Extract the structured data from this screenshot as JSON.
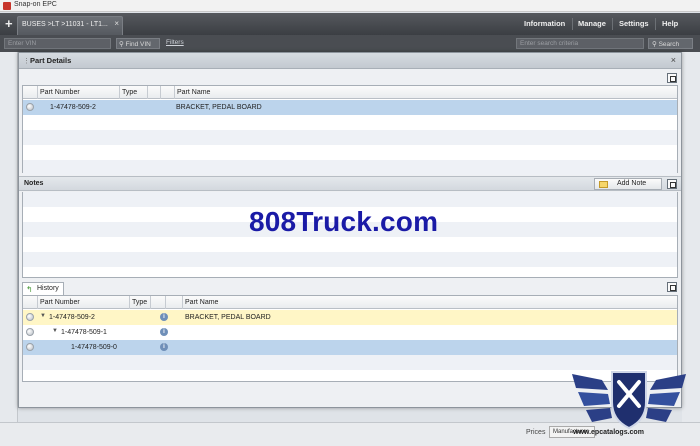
{
  "os": {
    "title": "Snap-on EPC"
  },
  "appbar": {
    "tab_label": "BUSES >LT >11031 - LT1...",
    "tab_close": "×",
    "menu": [
      "Information",
      "Manage",
      "Settings",
      "Help"
    ]
  },
  "searchbar": {
    "vin_placeholder": "Enter VIN",
    "find_vin": "Find VIN",
    "filters": "Filters",
    "criteria_placeholder": "Enter search criteria",
    "search": "Search"
  },
  "dialog": {
    "title": "Part Details",
    "close": "×",
    "parts_grid": {
      "columns": [
        "Part Number",
        "Type",
        "Part Name"
      ],
      "rows": [
        {
          "part_number": "1-47478-509-2",
          "type": "",
          "part_name": "BRACKET, PEDAL BOARD",
          "selected": true
        }
      ]
    },
    "notes": {
      "label": "Notes",
      "add_note": "Add Note"
    },
    "history": {
      "tab": "History",
      "columns": [
        "Part Number",
        "Type",
        "Part Name"
      ],
      "rows": [
        {
          "part_number": "1-47478-509-2",
          "part_name": "BRACKET, PEDAL BOARD",
          "level": 0,
          "expander": "▼",
          "state": "highlight"
        },
        {
          "part_number": "1-47478-509-1",
          "part_name": "",
          "level": 1,
          "expander": "▼",
          "state": "normal"
        },
        {
          "part_number": "1-47478-509-0",
          "part_name": "",
          "level": 2,
          "expander": "",
          "state": "selected"
        }
      ]
    }
  },
  "bottom": {
    "prices": "Prices",
    "manufacturer": "Manufacturer"
  },
  "watermark": "808Truck.com",
  "logo_caption": "www.epcatalogs.com",
  "colors": {
    "selected_row": "#bcd4ec",
    "highlight_row": "#fff6c6",
    "toolbar": "#46494e",
    "watermark": "#1a1aa6"
  }
}
